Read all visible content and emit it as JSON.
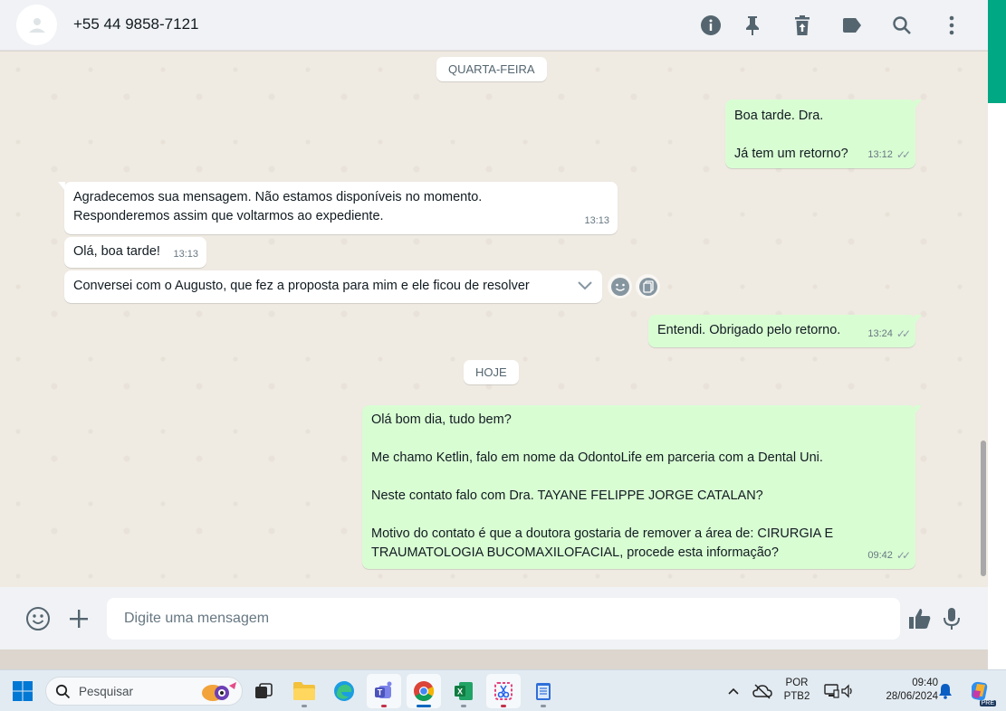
{
  "header": {
    "contact": "+55 44 9858-7121",
    "icons": [
      "info-icon",
      "pin-icon",
      "delete-icon",
      "label-icon",
      "search-icon",
      "menu-icon"
    ]
  },
  "chat": {
    "date_wednesday": "QUARTA-FEIRA",
    "date_today": "HOJE",
    "messages": [
      {
        "dir": "out",
        "lines": [
          "Boa tarde. Dra.",
          "",
          "Já tem um retorno?"
        ],
        "time": "13:12"
      },
      {
        "dir": "in",
        "lines": [
          "Agradecemos sua mensagem. Não estamos disponíveis no momento.",
          "Responderemos assim que voltarmos ao expediente."
        ],
        "time": "13:13"
      },
      {
        "dir": "in",
        "lines": [
          "Olá, boa tarde!"
        ],
        "time": "13:13"
      },
      {
        "dir": "in",
        "lines": [
          "Conversei com o Augusto, que fez a proposta para mim e ele ficou de resolver"
        ],
        "time": ""
      },
      {
        "dir": "out",
        "lines": [
          "Entendi. Obrigado pelo retorno."
        ],
        "time": "13:24"
      },
      {
        "dir": "out",
        "lines": [
          "Olá bom dia, tudo bem?",
          "",
          "Me chamo Ketlin, falo em nome da OdontoLife em parceria com a Dental Uni.",
          "",
          "Neste contato falo com Dra. TAYANE FELIPPE JORGE CATALAN?",
          "",
          "Motivo do contato é que a doutora gostaria de remover a área de: CIRURGIA E",
          "TRAUMATOLOGIA BUCOMAXILOFACIAL, procede esta informação?"
        ],
        "time": "09:42"
      }
    ]
  },
  "composer": {
    "placeholder": "Digite uma mensagem"
  },
  "taskbar": {
    "search_placeholder": "Pesquisar",
    "lang_top": "POR",
    "lang_bottom": "PTB2",
    "time": "09:40",
    "date": "28/06/2024",
    "copilot_badge": "PRE"
  },
  "colors": {
    "out_bubble": "#d9fdd3",
    "in_bubble": "#ffffff",
    "accent": "#00a884",
    "chat_bg": "#efeae2"
  }
}
